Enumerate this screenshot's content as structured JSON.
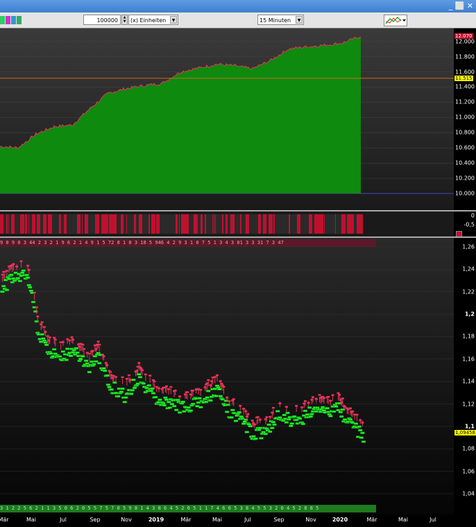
{
  "titlebar": {
    "controls_label": "_ ⬜ ✕"
  },
  "toolbar": {
    "quantity_value": "100000",
    "unit_label": "(x) Einheiten",
    "interval_label": "15 Minuten"
  },
  "colors": {
    "up": "#e8345a",
    "down": "#1ff02a",
    "area": "#0e8a0e",
    "hline": "#d2691e",
    "signal": "#c0102e"
  },
  "equity_panel": {
    "y_ticks": [
      "12.000",
      "11.800",
      "11.600",
      "11.400",
      "11.200",
      "11.000",
      "10.800",
      "10.600",
      "10.400",
      "10.200",
      "10.000"
    ],
    "current_label": "12.070",
    "hline_label": "11.515"
  },
  "indicator_panel": {
    "y_ticks": [
      "0",
      "-0,5"
    ]
  },
  "price_panel": {
    "strip_top": "9 0 9 0 3 44  2 3  2 1 9 6 2 1 4 9 1 5 72  8  1 8  3 18  5 946  4 2 9 3  1  0 7 5  1 3 4  3 01  3 3 31 7 3  47",
    "strip_bottom": "3 1 2 2 5 6 2 1 1 3 5 0 6 2 0 5 5 7 5 7 0 5 9 8 1 4 3 8 6 4 5 2 6 5 1 1 7 4 6 6 5 3 8 4 5 5 3 2 0 4 5 2 8 8 5",
    "y_ticks": [
      "1,26",
      "1,24",
      "1,22",
      "1,2",
      "1,18",
      "1,16",
      "1,14",
      "1,12",
      "1,1",
      "1,08",
      "1,06",
      "1,04"
    ],
    "last_price_label": "1,09458"
  },
  "x_axis": {
    "labels": [
      "Mär",
      "Mai",
      "Jul",
      "Sep",
      "Nov",
      "2019",
      "Mär",
      "Mai",
      "Jul",
      "Sep",
      "Nov",
      "2020",
      "Mär",
      "Mai",
      "Jul"
    ],
    "year_labels": [
      "2019",
      "2020"
    ]
  },
  "chart_data": [
    {
      "type": "area",
      "title": "",
      "ylim": [
        10000,
        12070
      ],
      "x": [
        0,
        0.05,
        0.1,
        0.15,
        0.2,
        0.25,
        0.3,
        0.35,
        0.4,
        0.45,
        0.5,
        0.55,
        0.6,
        0.65,
        0.7,
        0.75,
        0.8,
        0.85,
        0.9,
        0.95,
        1.0
      ],
      "series": [
        {
          "name": "",
          "values": [
            10620,
            10600,
            10780,
            10880,
            10900,
            11120,
            11320,
            11380,
            11420,
            11450,
            11600,
            11650,
            11700,
            11680,
            11640,
            11750,
            11900,
            11930,
            11950,
            11980,
            12070
          ]
        }
      ],
      "horizontal_line": 11515
    },
    {
      "type": "line",
      "title": "",
      "ylim": [
        1.03,
        1.26
      ],
      "x": [
        0,
        0.03,
        0.06,
        0.08,
        0.1,
        0.13,
        0.16,
        0.2,
        0.24,
        0.27,
        0.3,
        0.34,
        0.38,
        0.42,
        0.45,
        0.5,
        0.55,
        0.6,
        0.63,
        0.66,
        0.7,
        0.74,
        0.77,
        0.8,
        0.83,
        0.86,
        0.9,
        0.93,
        0.96,
        1.0
      ],
      "series": [
        {
          "name": "",
          "values": [
            1.225,
            1.235,
            1.238,
            1.232,
            1.19,
            1.17,
            1.165,
            1.17,
            1.155,
            1.165,
            1.14,
            1.13,
            1.145,
            1.13,
            1.125,
            1.12,
            1.125,
            1.135,
            1.115,
            1.11,
            1.095,
            1.1,
            1.115,
            1.108,
            1.11,
            1.118,
            1.115,
            1.12,
            1.105,
            1.0946
          ]
        }
      ]
    }
  ]
}
